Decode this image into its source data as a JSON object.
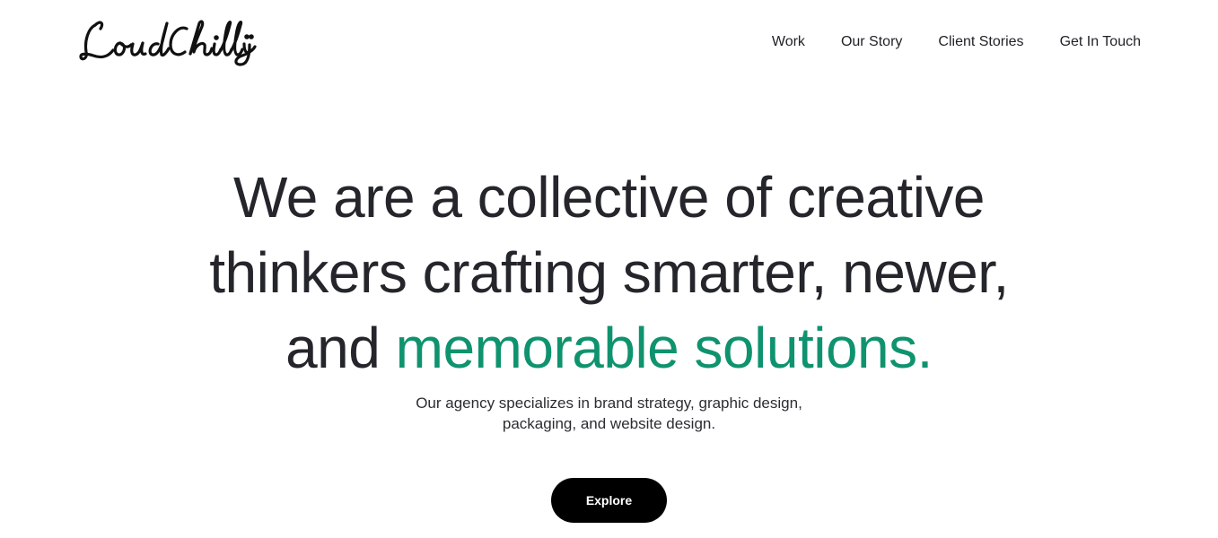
{
  "header": {
    "logo_text": "LoudChilli",
    "nav": [
      {
        "label": "Work"
      },
      {
        "label": "Our Story"
      },
      {
        "label": "Client Stories"
      },
      {
        "label": "Get In Touch"
      }
    ]
  },
  "hero": {
    "line1": "We are a collective of creative",
    "line2": "thinkers crafting smarter, newer,",
    "line3_plain": "and ",
    "line3_accent": "memorable solutions.",
    "subtext_line1": "Our agency specializes in brand strategy, graphic design,",
    "subtext_line2": "packaging, and website design.",
    "cta_label": "Explore"
  },
  "colors": {
    "accent": "#0f936e",
    "text": "#24262b",
    "button_bg": "#000000",
    "button_text": "#ffffff"
  }
}
